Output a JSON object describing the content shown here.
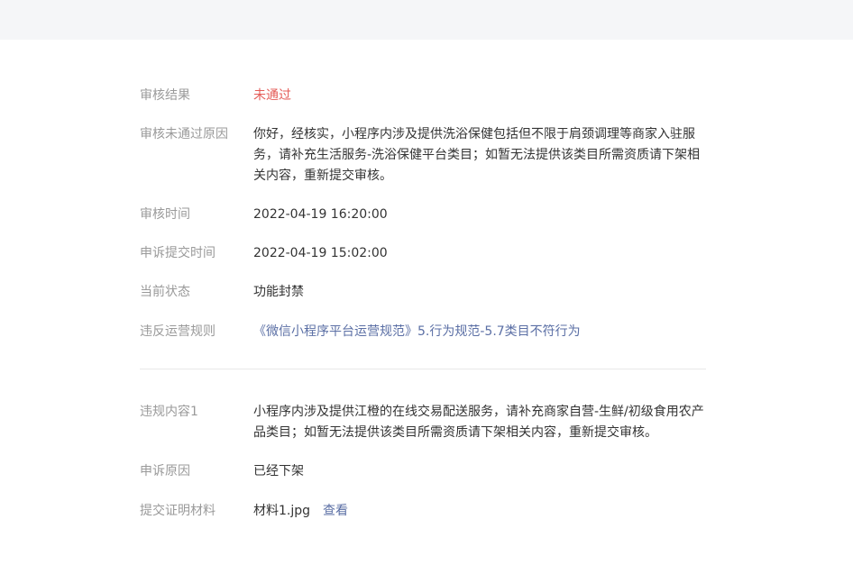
{
  "audit": {
    "result_label": "审核结果",
    "result_value": "未通过",
    "reason_label": "审核未通过原因",
    "reason_value": "你好，经核实，小程序内涉及提供洗浴保健包括但不限于肩颈调理等商家入驻服务，请补充生活服务-洗浴保健平台类目；如暂无法提供该类目所需资质请下架相关内容，重新提交审核。",
    "time_label": "审核时间",
    "time_value": "2022-04-19 16:20:00",
    "appeal_time_label": "申诉提交时间",
    "appeal_time_value": "2022-04-19 15:02:00",
    "status_label": "当前状态",
    "status_value": "功能封禁",
    "rule_label": "违反运营规则",
    "rule_value": "《微信小程序平台运营规范》5.行为规范-5.7类目不符行为"
  },
  "violation": {
    "content_label": "违规内容1",
    "content_value": "小程序内涉及提供江橙的在线交易配送服务，请补充商家自营-生鲜/初级食用农产品类目；如暂无法提供该类目所需资质请下架相关内容，重新提交审核。",
    "appeal_reason_label": "申诉原因",
    "appeal_reason_value": "已经下架",
    "material_label": "提交证明材料",
    "material_file": "材料1.jpg",
    "material_view": "查看"
  },
  "colors": {
    "fail_red": "#e45c58",
    "link_blue": "#5b6fa5",
    "label_gray": "#9a9a9a",
    "text_dark": "#333333",
    "topbar_bg": "#f5f6f8"
  }
}
